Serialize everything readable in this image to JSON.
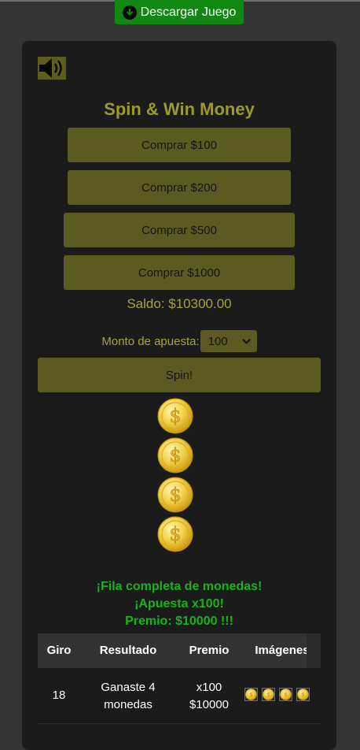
{
  "header": {
    "download_label": "Descargar Juego"
  },
  "game": {
    "title": "Spin & Win Money",
    "buy_buttons": [
      "Comprar $100",
      "Comprar $200",
      "Comprar $500",
      "Comprar $1000"
    ],
    "balance": "Saldo: $10300.00",
    "bet_label": "Monto de apuesta:",
    "bet_value": "100",
    "spin_label": "Spin!",
    "reel_symbols": [
      "coin-icon",
      "coin-icon",
      "coin-icon",
      "coin-icon"
    ],
    "result_lines": [
      "¡Fila completa de monedas!",
      "¡Apuesta x100!",
      "Premio: $10000 !!!"
    ]
  },
  "history": {
    "columns": [
      "Giro",
      "Resultado",
      "Premio",
      "Imágenes"
    ],
    "rows": [
      {
        "spin": "18",
        "result_line1": "Ganaste 4",
        "result_line2": "monedas",
        "prize_line1": "x100",
        "prize_line2": "$10000",
        "images": [
          "coin-icon",
          "coin-icon",
          "coin-icon",
          "coin-icon"
        ]
      }
    ]
  },
  "colors": {
    "page_bg": "#353535",
    "panel_bg": "#1b1b1b",
    "accent_olive": "#5b5a20",
    "title_olive": "#9c9a2f",
    "download_green": "#118811",
    "win_green": "#16b416"
  }
}
